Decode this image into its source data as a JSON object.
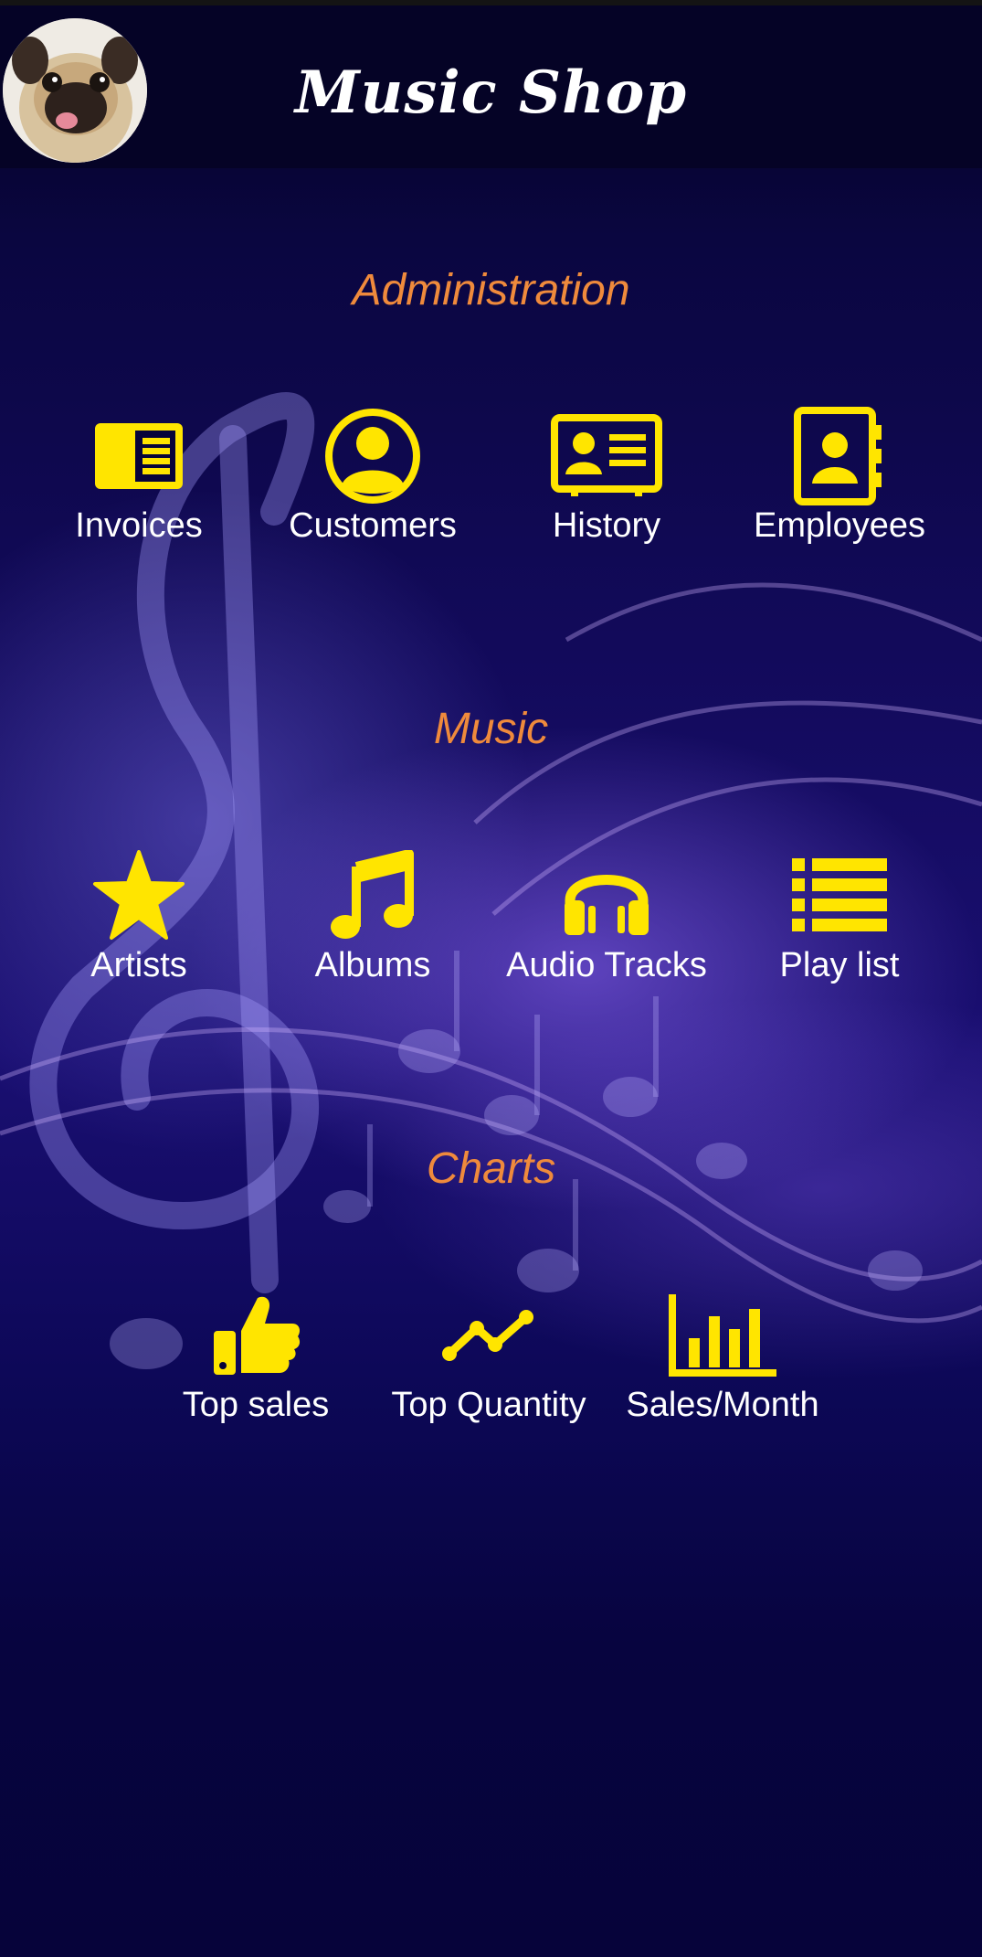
{
  "header": {
    "title": "Music Shop",
    "avatar": "pug-avatar"
  },
  "colors": {
    "icon": "#ffe500",
    "section_title": "#ef8a3c",
    "label": "#ffffff",
    "header_bg": "#050326",
    "background": "#120a5a"
  },
  "sections": [
    {
      "title": "Administration",
      "items": [
        {
          "label": "Invoices",
          "icon": "invoice-icon"
        },
        {
          "label": "Customers",
          "icon": "account-circle-icon"
        },
        {
          "label": "History",
          "icon": "contact-card-icon"
        },
        {
          "label": "Employees",
          "icon": "contact-book-icon"
        }
      ]
    },
    {
      "title": "Music",
      "items": [
        {
          "label": "Artists",
          "icon": "star-icon"
        },
        {
          "label": "Albums",
          "icon": "music-note-icon"
        },
        {
          "label": "Audio Tracks",
          "icon": "headphones-icon"
        },
        {
          "label": "Play list",
          "icon": "list-icon"
        }
      ]
    },
    {
      "title": "Charts",
      "items": [
        {
          "label": "Top sales",
          "icon": "thumbs-up-icon"
        },
        {
          "label": "Top  Quantity",
          "icon": "line-chart-icon"
        },
        {
          "label": "Sales/Month",
          "icon": "bar-chart-icon"
        }
      ]
    }
  ]
}
